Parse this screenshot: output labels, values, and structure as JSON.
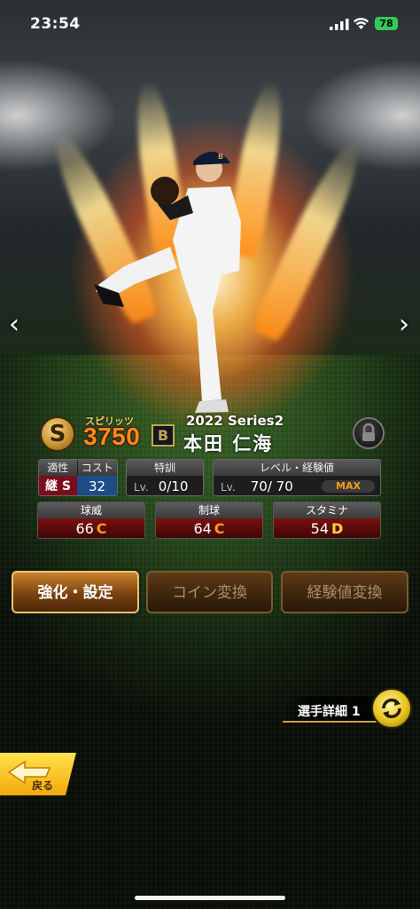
{
  "status_bar": {
    "time": "23:54",
    "battery": "78"
  },
  "card": {
    "spirit_label": "スピリッツ",
    "spirit_value": "3750",
    "rarity": "S",
    "team_logo": "B",
    "series": "2022 Series2",
    "player_name": "本田 仁海"
  },
  "stats": {
    "aptitude_label": "適性",
    "aptitude_value": "継",
    "aptitude_rank": "S",
    "cost_label": "コスト",
    "cost_value": "32",
    "training_label": "特訓",
    "training_lv": "Lv.",
    "training_value": "0/10",
    "level_label": "レベル・経験値",
    "level_lv": "Lv.",
    "level_value": "70/ 70",
    "level_max": "MAX",
    "ratings": [
      {
        "label": "球威",
        "value": "66",
        "grade": "C"
      },
      {
        "label": "制球",
        "value": "64",
        "grade": "C"
      },
      {
        "label": "スタミナ",
        "value": "54",
        "grade": "D"
      }
    ]
  },
  "buttons": {
    "enhance": "強化・設定",
    "coin": "コイン変換",
    "exp": "経験値変換"
  },
  "detail": {
    "label": "選手詳細 1"
  },
  "back": {
    "label": "戻る"
  },
  "colors": {
    "grade_c": "#ff9a1e",
    "grade_d": "#ffd23a",
    "max": "#ff9a1e",
    "cost_bg": "#1c4e86",
    "apt_bg": "#7a0e1c"
  }
}
